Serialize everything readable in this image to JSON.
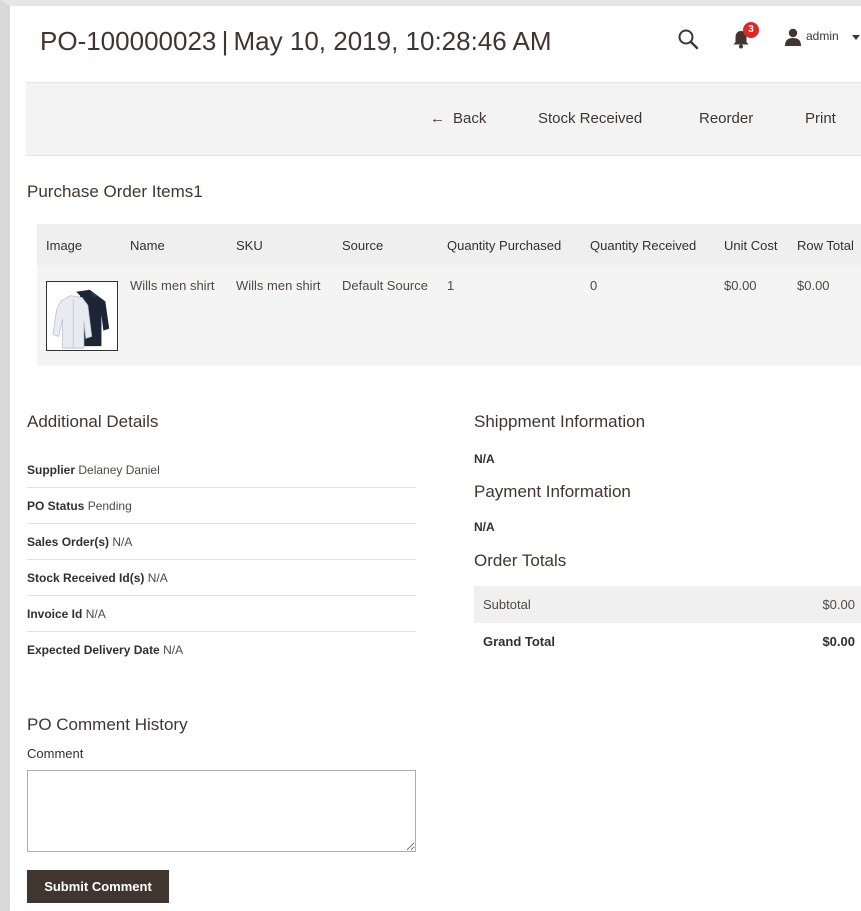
{
  "header": {
    "title": "PO-100000023 | May 10, 2019, 10:28:46 AM",
    "notifications_count": "3",
    "user_name": "admin"
  },
  "actions": {
    "back": "Back",
    "stock_received": "Stock Received",
    "reorder": "Reorder",
    "print": "Print"
  },
  "items": {
    "heading": "Purchase Order Items1",
    "columns": [
      "Image",
      "Name",
      "SKU",
      "Source",
      "Quantity Purchased",
      "Quantity Received",
      "Unit Cost",
      "Row Total"
    ],
    "rows": [
      {
        "name": "Wills men shirt",
        "sku": "Wills men shirt",
        "source": "Default Source",
        "qty_purchased": "1",
        "qty_received": "0",
        "unit_cost": "$0.00",
        "row_total": "$0.00"
      }
    ]
  },
  "additional": {
    "heading": "Additional Details",
    "rows": [
      {
        "label": "Supplier",
        "value": "Delaney Daniel"
      },
      {
        "label": "PO Status",
        "value": "Pending"
      },
      {
        "label": "Sales Order(s)",
        "value": "N/A"
      },
      {
        "label": "Stock Received Id(s)",
        "value": "N/A"
      },
      {
        "label": "Invoice Id",
        "value": "N/A"
      },
      {
        "label": "Expected Delivery Date",
        "value": "N/A"
      }
    ]
  },
  "shipment": {
    "heading": "Shippment Information",
    "value": "N/A"
  },
  "payment": {
    "heading": "Payment Information",
    "value": "N/A"
  },
  "totals": {
    "heading": "Order Totals",
    "subtotal_label": "Subtotal",
    "subtotal_value": "$0.00",
    "grand_label": "Grand Total",
    "grand_value": "$0.00"
  },
  "comments": {
    "heading": "PO Comment History",
    "label": "Comment",
    "submit_label": "Submit Comment"
  }
}
